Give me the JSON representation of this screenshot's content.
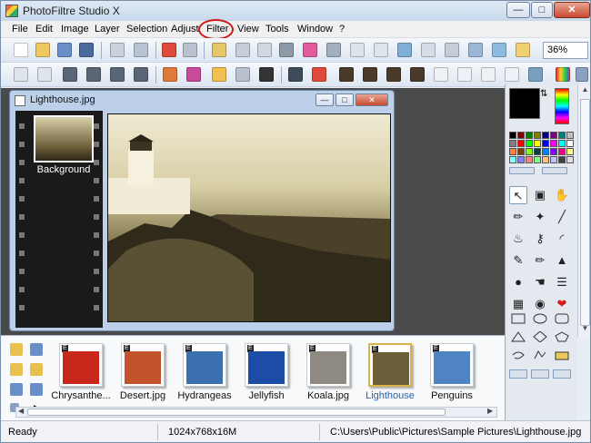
{
  "window": {
    "title": "PhotoFiltre Studio X"
  },
  "menu": [
    "File",
    "Edit",
    "Image",
    "Layer",
    "Selection",
    "Adjust",
    "Filter",
    "View",
    "Tools",
    "Window",
    "?"
  ],
  "toolbar": {
    "zoom": "36%"
  },
  "document": {
    "title": "Lighthouse.jpg",
    "layer_label": "Background"
  },
  "browser": {
    "thumbnails": [
      {
        "label": "Chrysanthe...",
        "color": "#c8281c"
      },
      {
        "label": "Desert.jpg",
        "color": "#c2532a"
      },
      {
        "label": "Hydrangeas",
        "color": "#3a6fb0"
      },
      {
        "label": "Jellyfish",
        "color": "#1c4da6"
      },
      {
        "label": "Koala.jpg",
        "color": "#8e8a82"
      },
      {
        "label": "Lighthouse",
        "color": "#6a5d38"
      },
      {
        "label": "Penguins",
        "color": "#4f84c4"
      }
    ],
    "selected": "Lighthouse"
  },
  "status": {
    "state": "Ready",
    "dimensions": "1024x768x16M",
    "path": "C:\\Users\\Public\\Pictures\\Sample Pictures\\Lighthouse.jpg"
  },
  "colors": {
    "highlight_ring": "#d01818",
    "accent": "#2a5fb0"
  }
}
